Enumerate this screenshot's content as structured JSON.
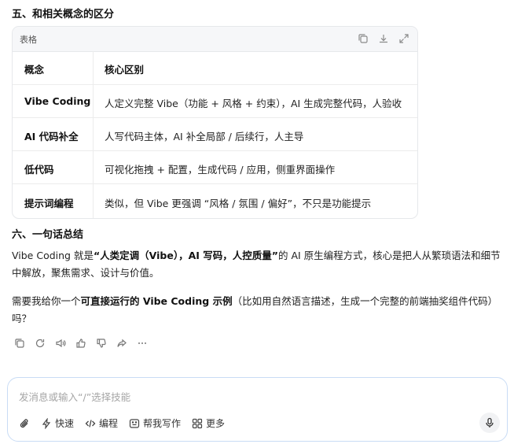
{
  "section5": {
    "title": "五、和相关概念的区分"
  },
  "table": {
    "label": "表格",
    "tools": [
      "copy-icon",
      "download-icon",
      "expand-icon"
    ],
    "headers": [
      "概念",
      "核心区别"
    ],
    "rows": [
      [
        "Vibe Coding",
        "人定义完整 Vibe（功能 + 风格 + 约束），AI 生成完整代码，人验收"
      ],
      [
        "AI 代码补全",
        "人写代码主体，AI 补全局部 / 后续行，人主导"
      ],
      [
        "低代码",
        "可视化拖拽 + 配置，生成代码 / 应用，侧重界面操作"
      ],
      [
        "提示词编程",
        "类似，但 Vibe 更强调 “风格 / 氛围 / 偏好”，不只是功能提示"
      ]
    ]
  },
  "section6": {
    "title": "六、一句话总结"
  },
  "summary": {
    "p1_pre": "Vibe Coding 就是",
    "p1_bold": "“人类定调（Vibe），AI 写码，人控质量”",
    "p1_post": "的 AI 原生编程方式，核心是把人从繁琐语法和细节中解放，聚焦需求、设计与价值。",
    "p2_pre": "需要我给你一个",
    "p2_bold": "可直接运行的 Vibe Coding 示例",
    "p2_post": "（比如用自然语言描述，生成一个完整的前端抽奖组件代码）吗？"
  },
  "actions": [
    "copy-icon",
    "refresh-icon",
    "speaker-icon",
    "thumbs-up-icon",
    "thumbs-down-icon",
    "share-icon",
    "more-icon"
  ],
  "composer": {
    "placeholder": "发消息或输入“/”选择技能",
    "buttons": [
      {
        "icon": "attach-icon",
        "label": ""
      },
      {
        "icon": "lightning-icon",
        "label": "快速"
      },
      {
        "icon": "code-icon",
        "label": "编程"
      },
      {
        "icon": "write-icon",
        "label": "帮我写作"
      },
      {
        "icon": "grid-icon",
        "label": "更多"
      }
    ]
  }
}
